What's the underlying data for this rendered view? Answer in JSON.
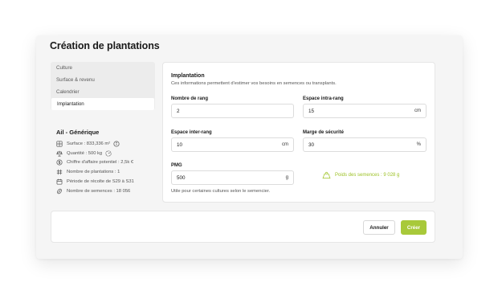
{
  "page": {
    "title": "Création de plantations"
  },
  "nav": {
    "items": [
      {
        "label": "Culture",
        "active": false
      },
      {
        "label": "Surface & revenu",
        "active": false
      },
      {
        "label": "Calendrier",
        "active": false
      },
      {
        "label": "Implantation",
        "active": true
      }
    ]
  },
  "summary": {
    "title": "Ail - Générique",
    "rows": [
      {
        "icon": "area-icon",
        "text": "Surface : 833,336 m²",
        "has_info": true
      },
      {
        "icon": "scale-icon",
        "text": "Quantité : 500 kg",
        "has_info": true
      },
      {
        "icon": "dollar-icon",
        "text": "Chiffre d'affaire potentiel : 2,5k €",
        "has_info": false
      },
      {
        "icon": "hash-icon",
        "text": "Nombre de plantations : 1",
        "has_info": false
      },
      {
        "icon": "calendar-icon",
        "text": "Période de récolte de S29 à S31",
        "has_info": false
      },
      {
        "icon": "seed-icon",
        "text": "Nombre de semences : 18 056",
        "has_info": false
      }
    ]
  },
  "implantation": {
    "title": "Implantation",
    "description": "Ces informations permettent d'estimer vos besoins en semences ou transplants.",
    "fields": {
      "rows_count": {
        "label": "Nombre de rang",
        "value": "2",
        "unit": ""
      },
      "intra_row": {
        "label": "Espace intra-rang",
        "value": "15",
        "unit": "cm"
      },
      "inter_row": {
        "label": "Espace inter-rang",
        "value": "10",
        "unit": "cm"
      },
      "safety_margin": {
        "label": "Marge de sécurité",
        "value": "30",
        "unit": "%"
      },
      "pmg": {
        "label": "PMG",
        "value": "500",
        "unit": "g"
      }
    },
    "seed_weight": "Poids des semences : 9 028 g",
    "hint": "Utile pour certaines cultures selon le semencier."
  },
  "footer": {
    "cancel_label": "Annuler",
    "create_label": "Créer"
  },
  "colors": {
    "accent": "#a8c93a",
    "accent_text": "#9cc125"
  }
}
